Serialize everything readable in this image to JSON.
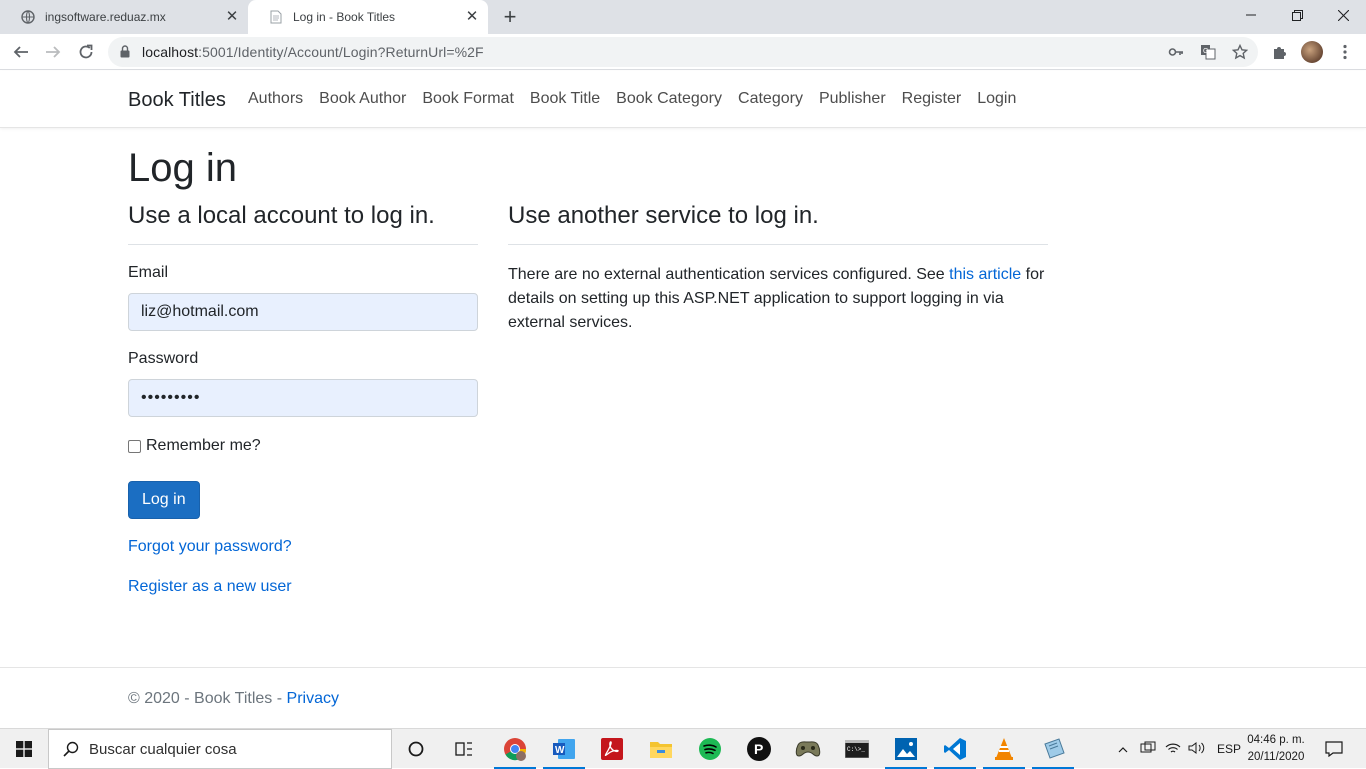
{
  "browser": {
    "tabs": [
      {
        "title": "ingsoftware.reduaz.mx",
        "active": false
      },
      {
        "title": "Log in - Book Titles",
        "active": true
      }
    ],
    "url_host": "localhost",
    "url_path": ":5001/Identity/Account/Login?ReturnUrl=%2F"
  },
  "navbar": {
    "brand": "Book Titles",
    "links": [
      "Authors",
      "Book Author",
      "Book Format",
      "Book Title",
      "Book Category",
      "Category",
      "Publisher",
      "Register",
      "Login"
    ]
  },
  "page": {
    "title": "Log in",
    "local_heading": "Use a local account to log in.",
    "email_label": "Email",
    "email_value": "liz@hotmail.com",
    "password_label": "Password",
    "password_value": "•••••••••",
    "remember_label": "Remember me?",
    "login_button": "Log in",
    "forgot_link": "Forgot your password?",
    "register_link": "Register as a new user",
    "external_heading": "Use another service to log in.",
    "external_text_1": "There are no external authentication services configured. See ",
    "external_link": "this article",
    "external_text_2": " for details on setting up this ASP.NET application to support logging in via external services."
  },
  "footer": {
    "copyright": "© 2020 - Book Titles - ",
    "privacy": "Privacy"
  },
  "taskbar": {
    "search_placeholder": "Buscar cualquier cosa",
    "language": "ESP",
    "time": "04:46 p. m.",
    "date": "20/11/2020"
  },
  "colors": {
    "link": "#0366d6",
    "primary_button": "#1b6ec2",
    "autofill_bg": "#e8f0fe"
  }
}
